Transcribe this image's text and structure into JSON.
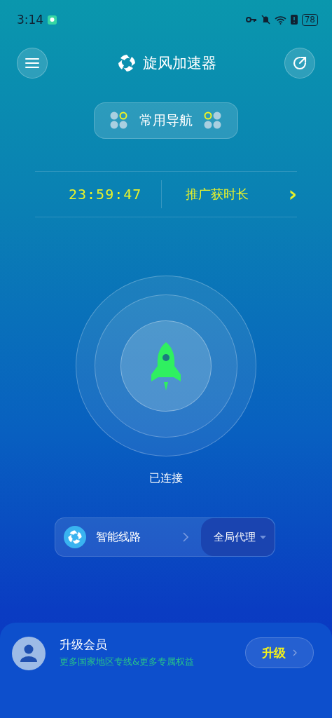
{
  "status_bar": {
    "time": "3:14",
    "battery": "78"
  },
  "header": {
    "title": "旋风加速器"
  },
  "nav_button": {
    "label": "常用导航"
  },
  "timer": {
    "remaining": "23:59:47",
    "promo": "推广获时长",
    "arrow": "›"
  },
  "connection": {
    "connected": true,
    "status": "已连接"
  },
  "route": {
    "line": "智能线路",
    "mode": "全局代理"
  },
  "member": {
    "title": "升级会员",
    "subtitle": "更多国家地区专线&更多专属权益",
    "button": "升级"
  }
}
